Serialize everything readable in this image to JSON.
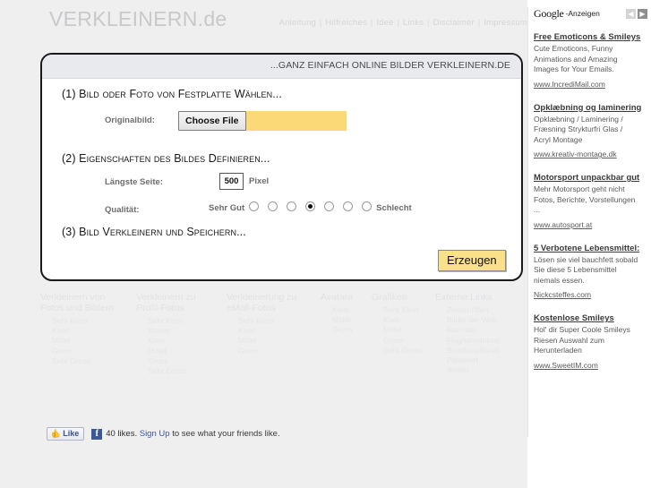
{
  "header": {
    "logo": "VERKLEINERN.de",
    "nav": [
      "Anleitung",
      "Hilfreiches",
      "Idee",
      "Links",
      "Disclaimer",
      "Impressum"
    ],
    "nav_separator": "|"
  },
  "panel": {
    "title": "...GANZ EINFACH ONLINE BILDER VERKLEINERN.DE",
    "step1_heading": "(1) Bild oder Foto von Festplatte Wählen...",
    "step2_heading": "(2) Eigenschaften des Bildes Definieren...",
    "step3_heading": "(3) Bild Verkleinern und Speichern...",
    "original_label": "Originalbild:",
    "choose_file_label": "Choose File",
    "file_name_value": "",
    "longest_side_label": "Längste Seite:",
    "pixel_value": "500",
    "pixel_unit": "Pixel",
    "quality_label": "Qualität:",
    "quality_best": "Sehr Gut",
    "quality_worst": "Schlecht",
    "quality_options_count": 7,
    "quality_selected_index": 3,
    "submit_label": "Erzeugen"
  },
  "footer_columns": [
    {
      "title": "Verkleinern von\nFotos und Bildern",
      "items": [
        "Sehr Klein",
        "Klein",
        "Mittel",
        "Gross",
        "Sehr Gross"
      ]
    },
    {
      "title": "Verkleinern zu\nProfil-Fotos",
      "items": [
        "Sehr Klein",
        "Kleiner",
        "Klein",
        "Mittel",
        "Gross",
        "Sehr Gross"
      ]
    },
    {
      "title": "Verkleinerung zu\neMail-Fotos",
      "items": [
        "Sehr Klein",
        "Klein",
        "Mittel",
        "Gross"
      ]
    },
    {
      "title": "Avatare",
      "items": [
        "Klein",
        "Mittel",
        "Gross"
      ]
    },
    {
      "title": "Grafiken",
      "items": [
        "Sehr Klein",
        "Klein",
        "Mittel",
        "Gross",
        "Sehr Gross"
      ]
    },
    {
      "title": "Externe Links",
      "items": [
        "Zeitschriften",
        "Bilder der Welt",
        "Kursabo",
        "Flughafenbilder",
        "Beschimpfomat",
        "Passwort",
        "Xetten"
      ]
    }
  ],
  "facebook": {
    "like_label": "Like",
    "thumb_icon": "thumbs-up-icon",
    "f_icon": "f",
    "count_text": "40 likes.",
    "signup_text": "Sign Up",
    "tail_text": "to see what your friends like."
  },
  "ads": {
    "brand": "Google",
    "brand_suffix": "-Anzeigen",
    "prev_arrow": "◀",
    "next_arrow": "▶",
    "items": [
      {
        "title": "Free Emoticons & Smileys",
        "lines": [
          "Cute Emoticons, Funny",
          "Animations and Amazing",
          "Images for Your Emails."
        ],
        "url": "www.IncrediMail.com"
      },
      {
        "title": "Opklæbning og laminering",
        "lines": [
          "Opklæbning / Laminering /",
          "Fræsning Strykturfri Glas /",
          "Acryl Montage"
        ],
        "url": "www.kreativ-montage.dk"
      },
      {
        "title": "Motorsport unpackbar gut",
        "lines": [
          "Mehr Motorsport geht nicht",
          "Fotos, Berichte, Vorstellungen",
          "..."
        ],
        "url": "www.autosport.at"
      },
      {
        "title": "5 Verbotene Lebensmittel:",
        "lines": [
          "Lösen sie viel bauchfett sobald",
          "Sie diese 5 Lebensmittel",
          "niemals essen."
        ],
        "url": "Nickcsteffes.com"
      },
      {
        "title": "Kostenlose Smileys",
        "lines": [
          "Hol' dir Super Coole Smileys",
          "Riesen Auswahl zum",
          "Herunterladen"
        ],
        "url": "www.SweetIM.com"
      }
    ]
  },
  "colors": {
    "page_bg": "#efeff0",
    "accent_yellow": "#fbd976",
    "button_yellow": "#fbe08a",
    "panel_border": "#1a1a1a",
    "facebook_blue": "#3b5998"
  }
}
